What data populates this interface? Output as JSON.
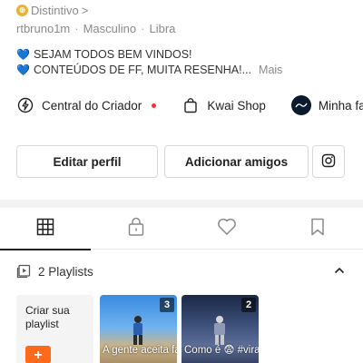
{
  "profile": {
    "badge_label": "Distintivo",
    "badge_chevron": ">",
    "badge_glyph": "⊕",
    "username": "rtbruno1m",
    "gender": "Masculino",
    "sign": "Libra",
    "separator": "·",
    "bio_line_1": "SEJAM TODOS BEM VINDOS!",
    "bio_line_2": "CONTEÚDOS DE FF, MUITA RESENHA!...",
    "bio_more": "Mais",
    "heart_glyph": "💙"
  },
  "quick_links": {
    "creator_center": "Central do Criador",
    "kwai_shop": "Kwai Shop",
    "minha_fa": "Minha fa"
  },
  "actions": {
    "edit_profile": "Editar perfil",
    "add_friends": "Adicionar amigos"
  },
  "tabs": {
    "icons": [
      "grid-icon",
      "lock-icon",
      "heart-icon",
      "bookmark-icon"
    ],
    "active_index": 0
  },
  "playlists": {
    "header": "2 Playlists",
    "create_label": "Criar sua playlist",
    "create_plus": "+",
    "items": [
      {
        "count": "3",
        "title": "A gente aceita fazfir"
      },
      {
        "count": "2",
        "title": "Como é 😨 #viralize #Fre"
      }
    ]
  },
  "colors": {
    "accent": "#ff6a1a",
    "notification_dot": "#ff2d2d",
    "badge_gold": "#e7b334",
    "bio_heart": "#2f7fd6"
  }
}
